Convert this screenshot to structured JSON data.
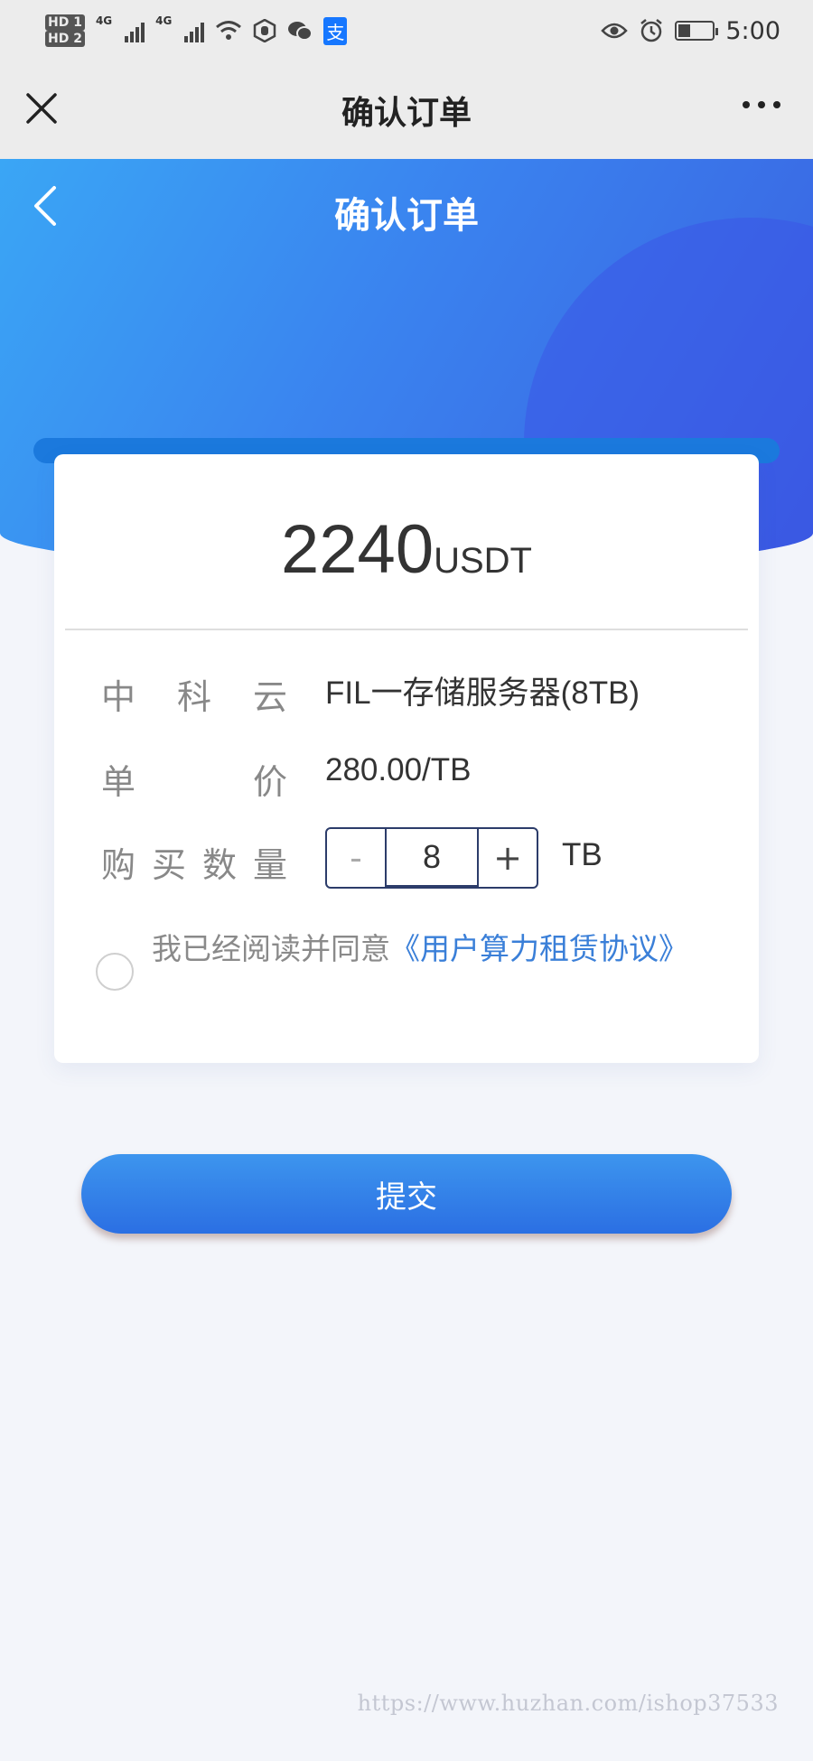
{
  "status_bar": {
    "hd1": "HD 1",
    "hd2": "HD 2",
    "net1": "4G",
    "net2": "4G",
    "icons": [
      "wifi-icon",
      "hand-icon",
      "wechat-icon",
      "alipay-icon",
      "eye-icon",
      "alarm-icon",
      "battery-icon"
    ],
    "alipay_glyph": "支",
    "battery_level": 0.35,
    "time": "5:00"
  },
  "app_bar": {
    "title": "确认订单",
    "close_icon": "close-icon",
    "more_icon": "more-icon"
  },
  "hero": {
    "title": "确认订单",
    "back_icon": "chevron-left-icon"
  },
  "order": {
    "amount": "2240",
    "currency": "USDT",
    "rows": [
      {
        "label_chars": [
          "中",
          "科",
          "云"
        ],
        "value": "FIL一存储服务器(8TB)"
      },
      {
        "label_chars": [
          "单",
          "价"
        ],
        "value": "280.00/TB"
      }
    ],
    "quantity": {
      "label_chars": [
        "购",
        "买",
        "数",
        "量"
      ],
      "minus": "-",
      "value": "8",
      "plus": "+",
      "unit": "TB"
    },
    "agreement": {
      "prefix": "我已经阅读并同意",
      "link": "《用户算力租赁协议》",
      "checked": false
    }
  },
  "submit_label": "提交",
  "watermark": "https://www.huzhan.com/ishop37533",
  "colors": {
    "primary": "#2b6fe3",
    "link": "#3a7fd8",
    "hero_start": "#3aa6f5",
    "hero_end": "#3a5fe0"
  }
}
